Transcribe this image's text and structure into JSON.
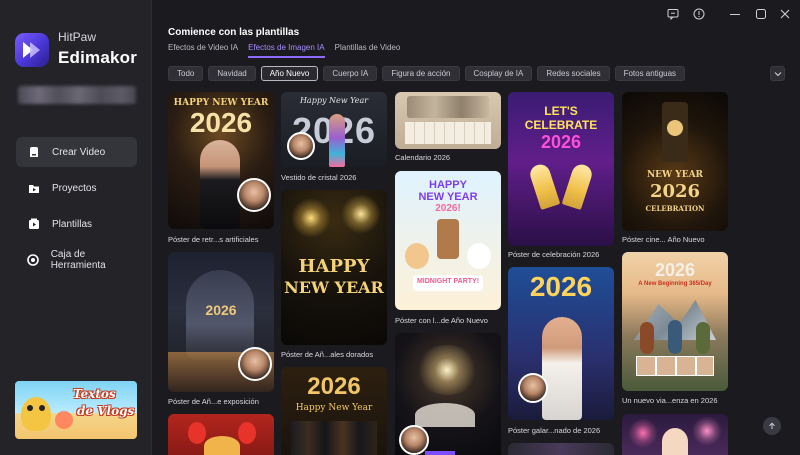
{
  "app": {
    "brand_top": "HitPaw",
    "brand_bottom": "Edimakor"
  },
  "sidebar": {
    "items": [
      {
        "label": "Crear Video",
        "icon": "create-video-icon",
        "active": true
      },
      {
        "label": "Proyectos",
        "icon": "projects-icon",
        "active": false
      },
      {
        "label": "Plantillas",
        "icon": "templates-icon",
        "active": false
      },
      {
        "label": "Caja de Herramienta",
        "icon": "toolbox-icon",
        "active": false
      }
    ],
    "banner": {
      "line1": "Textos",
      "line2": "de Vlogs"
    }
  },
  "header": {
    "title": "Comience con las plantillas",
    "tabs": [
      {
        "label": "Efectos de Video IA",
        "active": false
      },
      {
        "label": "Efectos de Imagen IA",
        "active": true
      },
      {
        "label": "Plantillas de Video",
        "active": false
      }
    ]
  },
  "filters": [
    {
      "label": "Todo",
      "active": false
    },
    {
      "label": "Navidad",
      "active": false
    },
    {
      "label": "Año Nuevo",
      "active": true
    },
    {
      "label": "Cuerpo IA",
      "active": false
    },
    {
      "label": "Figura de acción",
      "active": false
    },
    {
      "label": "Cosplay de IA",
      "active": false
    },
    {
      "label": "Redes sociales",
      "active": false
    },
    {
      "label": "Fotos antiguas",
      "active": false
    }
  ],
  "cards": {
    "c1": {
      "caption": "Póster de retr...s artificiales",
      "text1": "HAPPY NEW YEAR",
      "text2": "2026"
    },
    "c2": {
      "caption": "Póster de Añ...e exposición",
      "text1": "2026"
    },
    "c3": {
      "caption": "Vestido de cristal 2026",
      "text1": "Happy New Year",
      "text2": "2026"
    },
    "c4": {
      "caption": "Póster de Añ...ales dorados",
      "text1": "HAPPY",
      "text2": "NEW YEAR"
    },
    "c5": {
      "text1": "2026",
      "text2": "Happy New Year"
    },
    "c6": {
      "caption": "Calendario 2026"
    },
    "c7": {
      "caption": "Póster con l...de Año Nuevo",
      "text1": "HAPPY",
      "text2": "NEW YEAR",
      "text3": "2026!",
      "text4": "MIDNIGHT PARTY!"
    },
    "c9": {
      "caption": "Póster de celebración 2026",
      "text1": "LET'S",
      "text2": "CELEBRATE",
      "text3": "2026"
    },
    "c10": {
      "caption": "Póster galar...nado de 2026",
      "text1": "2026"
    },
    "c11": {
      "caption": "Póster cine... Año Nuevo",
      "text1": "NEW YEAR",
      "text2": "2026",
      "text3": "CELEBRATION"
    },
    "c12": {
      "caption": "Un nuevo via...enza en 2026",
      "text1": "2026",
      "text2": "A New Beginning 365/Day"
    }
  }
}
